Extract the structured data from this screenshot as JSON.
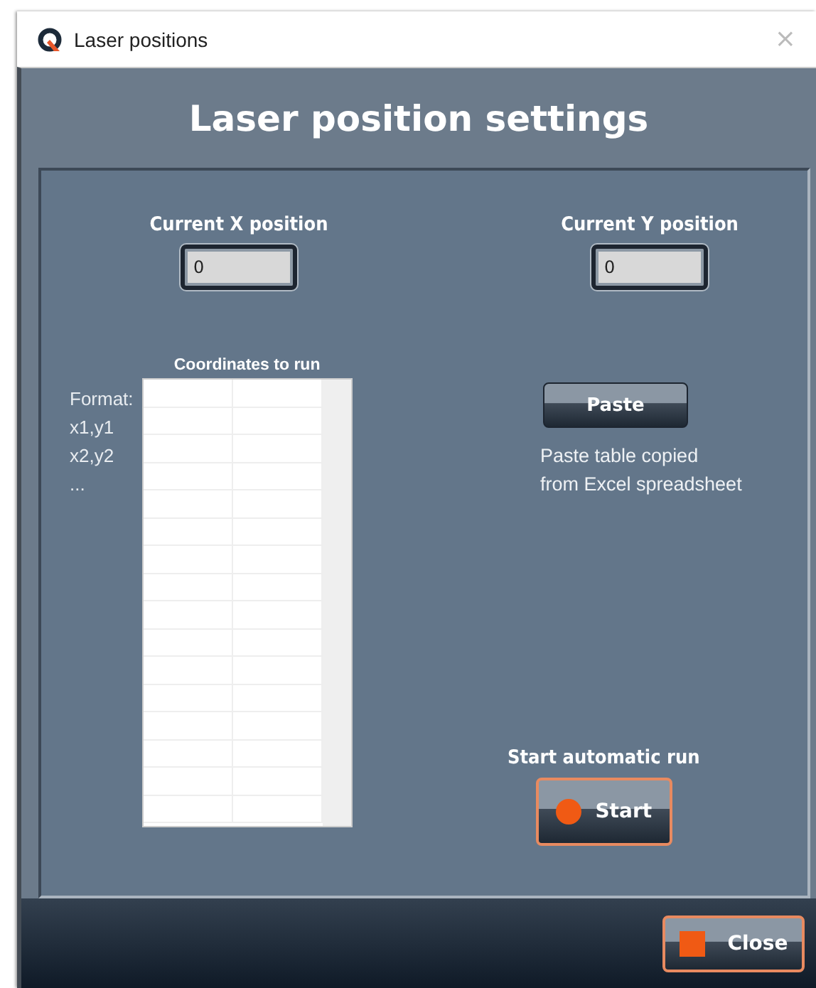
{
  "window": {
    "title": "Laser positions",
    "close": "×"
  },
  "heading": "Laser position settings",
  "x_position": {
    "label": "Current X position",
    "value": "0"
  },
  "y_position": {
    "label": "Current Y position",
    "value": "0"
  },
  "format_note": [
    "Format:",
    "x1,y1",
    "x2,y2",
    "..."
  ],
  "table": {
    "title": "Coordinates to run"
  },
  "paste": {
    "button": "Paste",
    "note": [
      "Paste table copied",
      "from Excel spreadsheet"
    ]
  },
  "run": {
    "label": "Start automatic run",
    "button": "Start"
  },
  "close_button": "Close"
}
